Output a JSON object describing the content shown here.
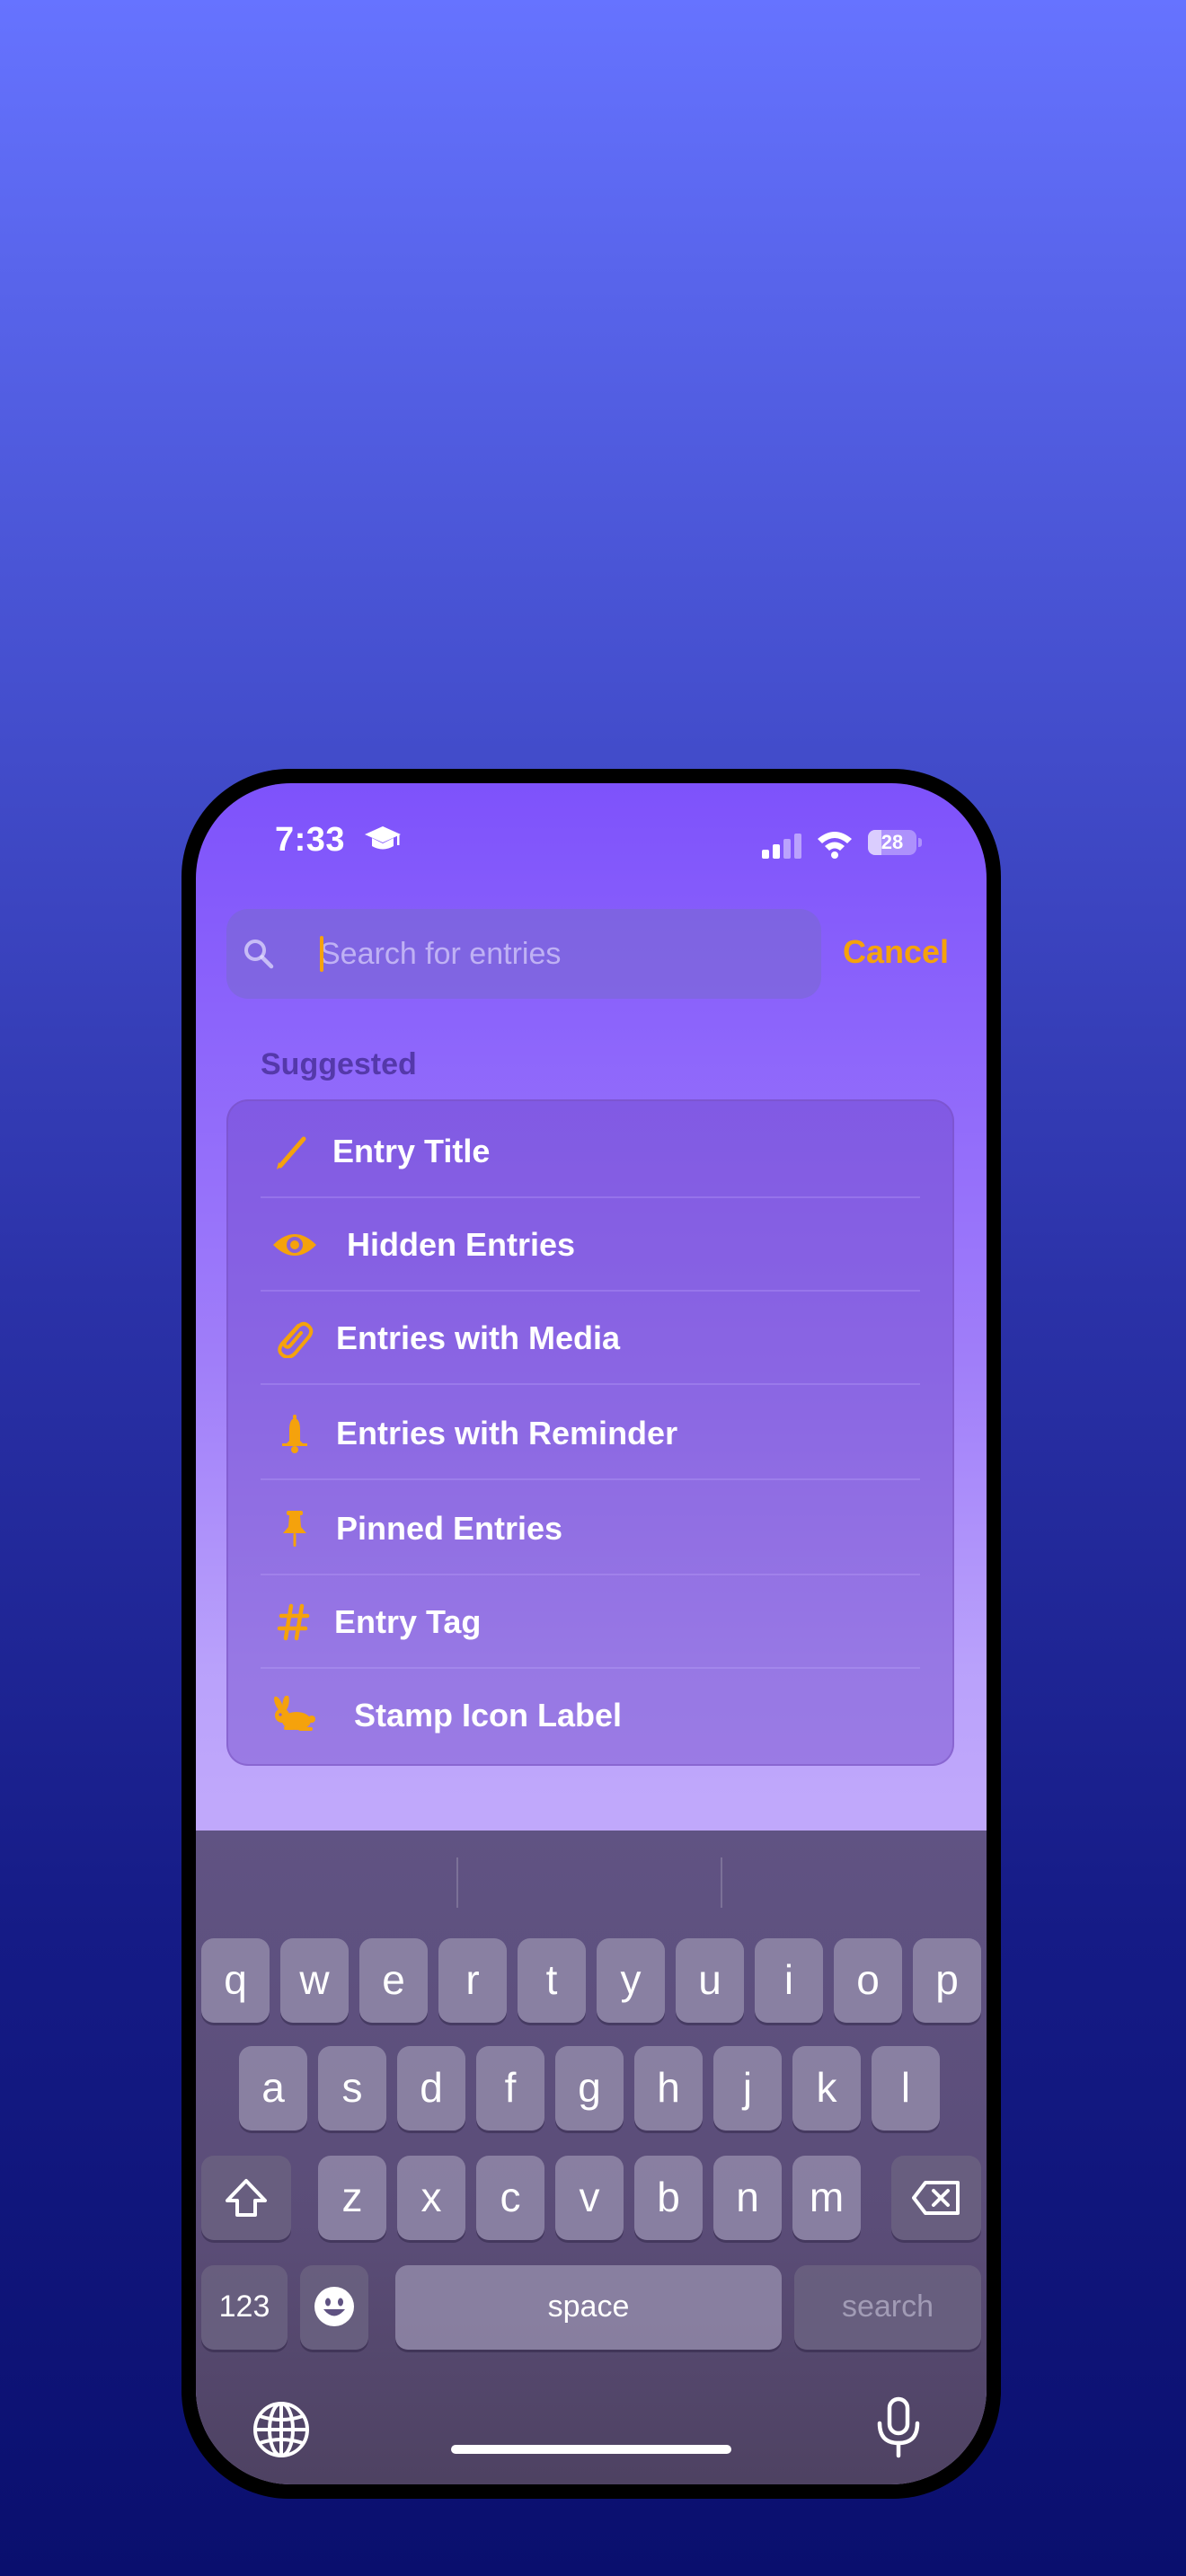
{
  "status_bar": {
    "time": "7:33",
    "battery": "28",
    "battery_fraction": 0.28
  },
  "search": {
    "placeholder": "Search for entries",
    "value": "",
    "cancel_label": "Cancel"
  },
  "suggested": {
    "title": "Suggested",
    "items": [
      {
        "label": "Entry Title",
        "icon": "pencil-icon"
      },
      {
        "label": "Hidden Entries",
        "icon": "eye-icon"
      },
      {
        "label": "Entries with Media",
        "icon": "paperclip-icon"
      },
      {
        "label": "Entries with Reminder",
        "icon": "bell-icon"
      },
      {
        "label": "Pinned Entries",
        "icon": "pin-icon"
      },
      {
        "label": "Entry Tag",
        "icon": "hashtag-icon"
      },
      {
        "label": "Stamp Icon Label",
        "icon": "rabbit-icon"
      }
    ]
  },
  "keyboard": {
    "row1": [
      "q",
      "w",
      "e",
      "r",
      "t",
      "y",
      "u",
      "i",
      "o",
      "p"
    ],
    "row2": [
      "a",
      "s",
      "d",
      "f",
      "g",
      "h",
      "j",
      "k",
      "l"
    ],
    "row3": [
      "z",
      "x",
      "c",
      "v",
      "b",
      "n",
      "m"
    ],
    "numbers_label": "123",
    "space_label": "space",
    "return_label": "search"
  },
  "colors": {
    "accent": "#f5a20c",
    "text": "#ffffff"
  }
}
